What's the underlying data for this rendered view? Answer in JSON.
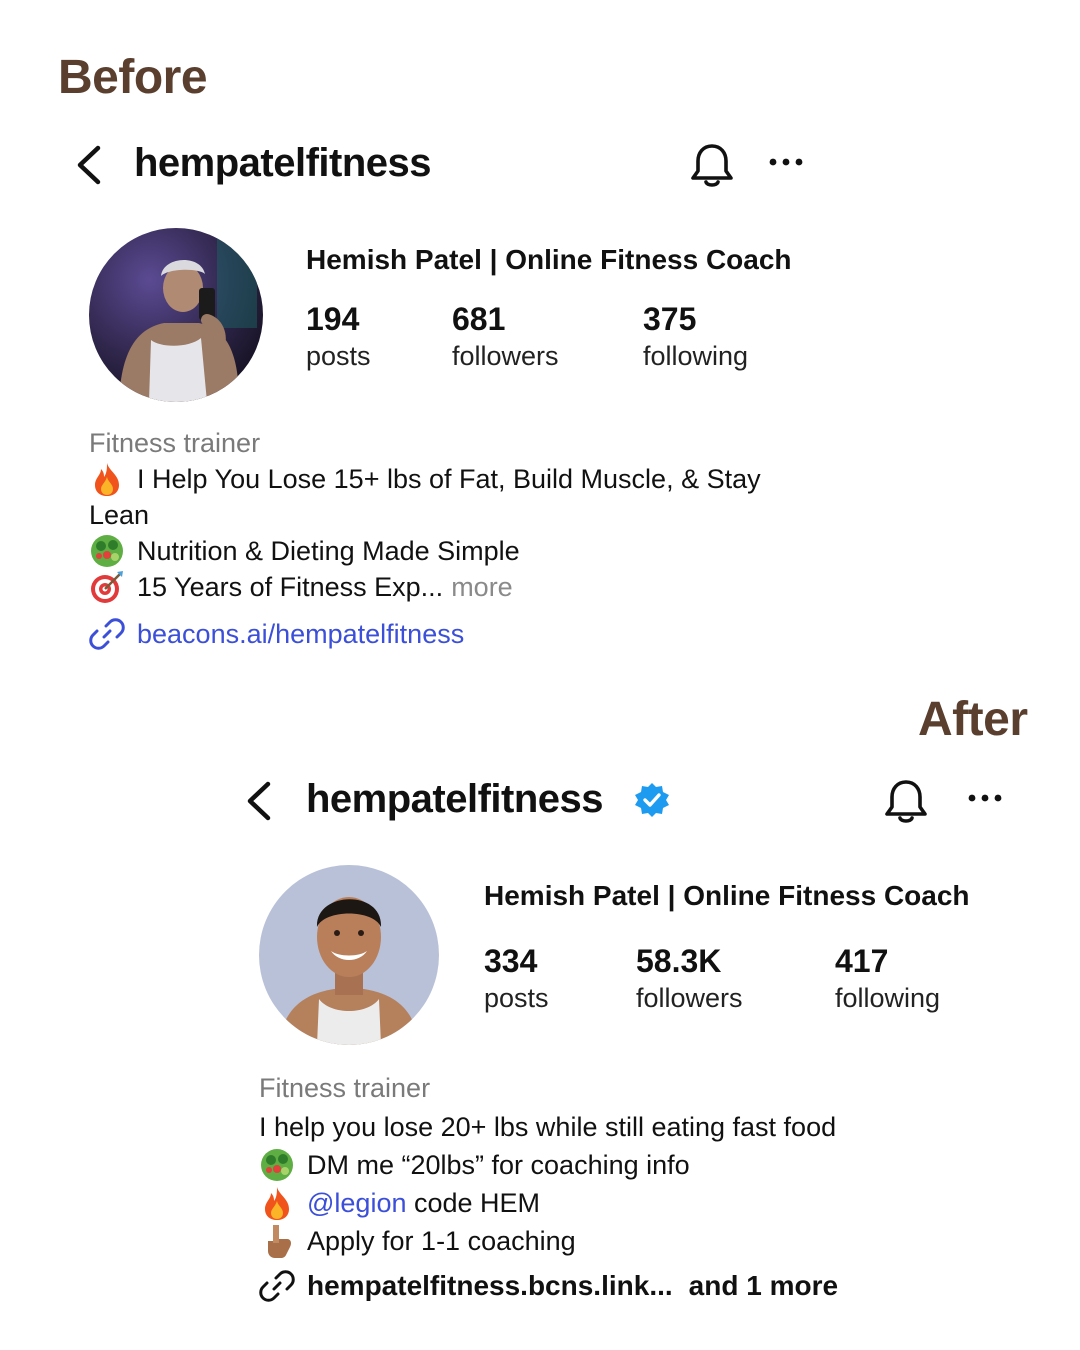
{
  "labels": {
    "before": "Before",
    "after": "After"
  },
  "before": {
    "username": "hempatelfitness",
    "display_name": "Hemish Patel | Online Fitness Coach",
    "stats": {
      "posts": {
        "value": "194",
        "label": "posts"
      },
      "followers": {
        "value": "681",
        "label": "followers"
      },
      "following": {
        "value": "375",
        "label": "following"
      }
    },
    "category": "Fitness trainer",
    "bio": {
      "line1": "I Help You Lose 15+ lbs of Fat, Build Muscle, & Stay",
      "line1_wrap": "Lean",
      "line2": "Nutrition & Dieting Made Simple",
      "line3": "15 Years of Fitness Exp...",
      "more": "more"
    },
    "link": "beacons.ai/hempatelfitness",
    "link_color": "#3b4fd8"
  },
  "after": {
    "username": "hempatelfitness",
    "verified": true,
    "display_name": "Hemish Patel | Online Fitness Coach",
    "stats": {
      "posts": {
        "value": "334",
        "label": "posts"
      },
      "followers": {
        "value": "58.3K",
        "label": "followers"
      },
      "following": {
        "value": "417",
        "label": "following"
      }
    },
    "category": "Fitness trainer",
    "bio": {
      "line1": "I help you lose 20+ lbs while still eating fast food",
      "line2": "DM me “20lbs” for coaching info",
      "line3_mention": "@legion",
      "line3_text": " code HEM",
      "line4": "Apply for 1-1 coaching"
    },
    "link": "hempatelfitness.bcns.link...",
    "link_more": "and 1 more"
  },
  "icons": {
    "back": "chevron-left-icon",
    "bell": "bell-icon",
    "more": "more-horizontal-icon",
    "link": "link-icon",
    "verified": "verified-badge-icon",
    "fire": "fire-emoji",
    "salad": "salad-emoji",
    "target": "target-emoji",
    "point_down": "pointing-down-emoji"
  },
  "colors": {
    "label_brown": "#5a3e2e",
    "verified_blue": "#1d9bf0",
    "mention_blue": "#3b4fd8"
  }
}
